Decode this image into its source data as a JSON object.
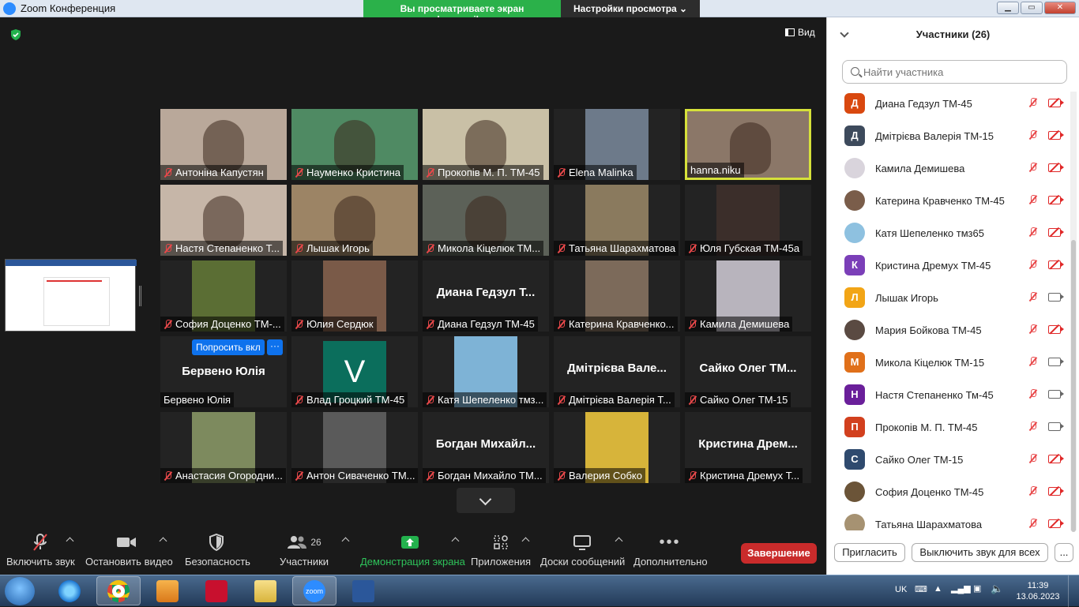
{
  "window": {
    "title": "Zoom Конференция"
  },
  "share_banner": {
    "viewing": "Вы просматриваете экран hanna.niku",
    "view_settings": "Настройки просмотра"
  },
  "stage": {
    "view_label": "Вид"
  },
  "tiles": [
    {
      "name": "Антоніна Капустян",
      "muted": true,
      "kind": "video",
      "color": "#b9a89a"
    },
    {
      "name": "Науменко Кристина",
      "muted": true,
      "kind": "video",
      "color": "#4f8a63"
    },
    {
      "name": "Прокопів М. П. ТМ-45",
      "muted": true,
      "kind": "video",
      "color": "#c9c0a6"
    },
    {
      "name": "Elena Malinka",
      "muted": true,
      "kind": "photo",
      "color": "#6d7a8a"
    },
    {
      "name": "hanna.niku",
      "muted": false,
      "kind": "video",
      "color": "#8b7768",
      "active": true
    },
    {
      "name": "Настя Степаненко Т...",
      "muted": true,
      "kind": "video",
      "color": "#c6b6a8"
    },
    {
      "name": "Лышак Игорь",
      "muted": true,
      "kind": "video",
      "color": "#9c8465"
    },
    {
      "name": "Микола Кіцелюк ТМ...",
      "muted": true,
      "kind": "video",
      "color": "#5c6158"
    },
    {
      "name": "Татьяна Шарахматова",
      "muted": true,
      "kind": "photo",
      "color": "#8a7a5e"
    },
    {
      "name": "Юля Губская ТМ-45а",
      "muted": true,
      "kind": "photo",
      "color": "#3b2e2a"
    },
    {
      "name": "София Доценко ТМ-...",
      "muted": true,
      "kind": "photo",
      "color": "#5b6e34"
    },
    {
      "name": "Юлия Сердюк",
      "muted": true,
      "kind": "photo",
      "color": "#7a5a48"
    },
    {
      "name": "Диана Гедзул ТМ-45",
      "muted": true,
      "kind": "name",
      "big": "Диана Гедзул Т..."
    },
    {
      "name": "Катерина Кравченко...",
      "muted": true,
      "kind": "photo",
      "color": "#7c6a5a"
    },
    {
      "name": "Камила Демишева",
      "muted": true,
      "kind": "photo",
      "color": "#b8b4bd"
    },
    {
      "name": "Бервено Юлія",
      "muted": false,
      "kind": "name",
      "big": "Бервено Юлія",
      "ask": "Попросить вкл"
    },
    {
      "name": "Влад Гроцкий ТМ-45",
      "muted": true,
      "kind": "letter",
      "letter": "V"
    },
    {
      "name": "Катя Шепеленко тмз...",
      "muted": true,
      "kind": "photo",
      "color": "#7eb3d6"
    },
    {
      "name": "Дмітрієва Валерія Т...",
      "muted": true,
      "kind": "name",
      "big": "Дмітрієва Вале..."
    },
    {
      "name": "Сайко Олег ТМ-15",
      "muted": true,
      "kind": "name",
      "big": "Сайко Олег ТМ..."
    },
    {
      "name": "Анастасия Огородни...",
      "muted": true,
      "kind": "photo",
      "color": "#7d8a5e"
    },
    {
      "name": "Антон Сиваченко ТМ...",
      "muted": true,
      "kind": "photo",
      "color": "#5a5a5a"
    },
    {
      "name": "Богдан Михайло ТМ...",
      "muted": true,
      "kind": "name",
      "big": "Богдан Михайл..."
    },
    {
      "name": "Валерия Собко",
      "muted": true,
      "kind": "photo",
      "color": "#d7b43a"
    },
    {
      "name": "Кристина Дремух Т...",
      "muted": true,
      "kind": "name",
      "big": "Кристина Дрем..."
    }
  ],
  "toolbar": {
    "unmute": "Включить звук",
    "stop_video": "Остановить видео",
    "security": "Безопасность",
    "participants": "Участники",
    "participants_count": "26",
    "share_screen": "Демонстрация экрана",
    "apps": "Приложения",
    "whiteboards": "Доски сообщений",
    "more": "Дополнительно",
    "end": "Завершение"
  },
  "panel": {
    "title": "Участники (26)",
    "search_placeholder": "Найти участника",
    "invite": "Пригласить",
    "mute_all": "Выключить звук для всех",
    "more": "...",
    "participants": [
      {
        "name": "Диана Гедзул ТМ-45",
        "initial": "Д",
        "color": "#d9480f",
        "cam": false
      },
      {
        "name": "Дмітрієва Валерія ТМ-15",
        "initial": "Д",
        "color": "#3d4a5c",
        "cam": false
      },
      {
        "name": "Камила Демишева",
        "initial": "",
        "color": "#d9d4dc",
        "cam": false,
        "photo": true
      },
      {
        "name": "Катерина Кравченко ТМ-45",
        "initial": "",
        "color": "#7a5d4a",
        "cam": false,
        "photo": true
      },
      {
        "name": "Катя Шепеленко тмз65",
        "initial": "",
        "color": "#8ec1e0",
        "cam": false,
        "photo": true
      },
      {
        "name": "Кристина Дремух ТМ-45",
        "initial": "К",
        "color": "#7b3fb8",
        "cam": false
      },
      {
        "name": "Лышак Игорь",
        "initial": "Л",
        "color": "#f2a516",
        "cam": true
      },
      {
        "name": "Мария Бойкова ТМ-45",
        "initial": "",
        "color": "#5a4a42",
        "cam": false,
        "photo": true
      },
      {
        "name": "Микола Кіцелюк ТМ-15",
        "initial": "М",
        "color": "#e0701a",
        "cam": true
      },
      {
        "name": "Настя Степаненко Тм-45",
        "initial": "Н",
        "color": "#6a1f9a",
        "cam": true
      },
      {
        "name": "Прокопів М. П. ТМ-45",
        "initial": "П",
        "color": "#d2401e",
        "cam": true
      },
      {
        "name": "Сайко Олег ТМ-15",
        "initial": "С",
        "color": "#2f4a6e",
        "cam": false
      },
      {
        "name": "София Доценко ТМ-45",
        "initial": "",
        "color": "#6b5438",
        "cam": false,
        "photo": true
      },
      {
        "name": "Татьяна Шарахматова",
        "initial": "",
        "color": "#a69272",
        "cam": false,
        "photo": true
      }
    ]
  },
  "taskbar": {
    "lang": "UK",
    "time": "11:39",
    "date": "13.06.2023",
    "zoom_label": "zoom"
  }
}
